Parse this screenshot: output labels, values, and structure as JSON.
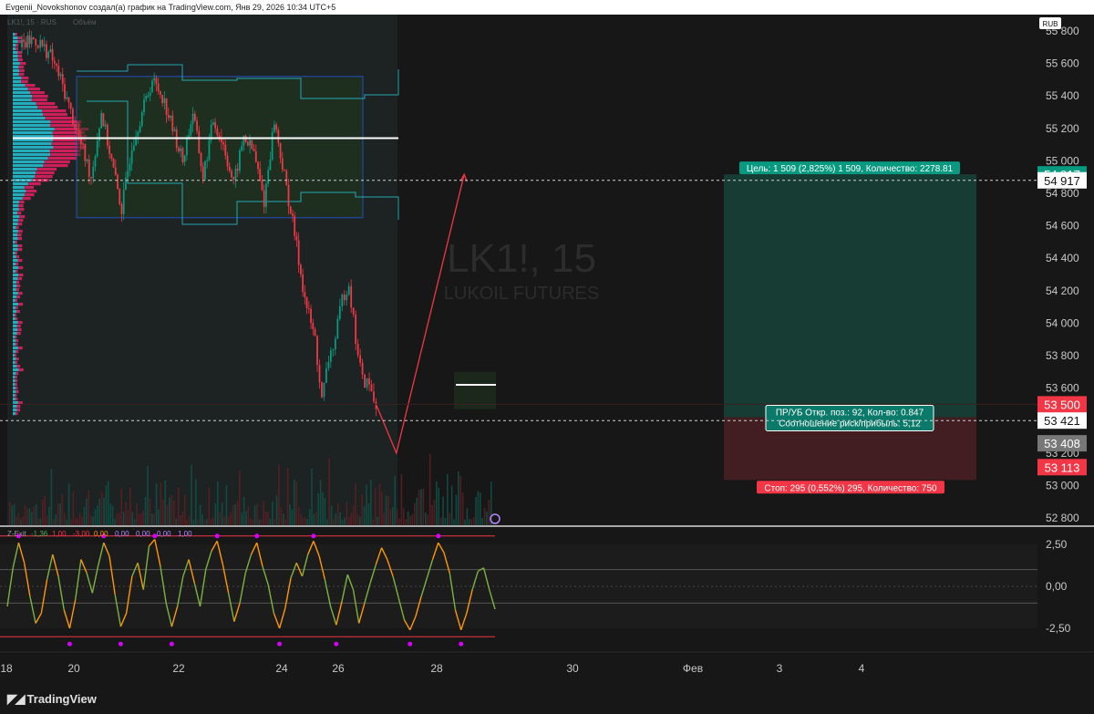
{
  "header": {
    "author_line": "Evgenii_Novokshonov создал(а) график на TradingView.com, Янв 29, 2026 10:34 UTC+5"
  },
  "legend": {
    "symbol_line": "LK1!, 15 · RUS",
    "volume_label": "Объём"
  },
  "currency_badge": "RUB",
  "watermark": {
    "symbol": "LK1!, 15",
    "name": "LUKOIL FUTURES"
  },
  "position": {
    "target_label": "Цель: 1 509 (2,825%) 1 509, Количество: 2278.81",
    "stop_label": "Стоп: 295 (0,552%) 295, Количество: 750",
    "pnl_line1": "ПР/УБ Откр. поз.: 92, Кол-во: 0.847",
    "pnl_line2": "Соотношение риск/прибыль: 5,12"
  },
  "price_tags": [
    {
      "text": "54 917",
      "price": 54917,
      "bg": "#089981",
      "fg": "#ffffff"
    },
    {
      "text": "54 917",
      "price": 54880,
      "bg": "#ffffff",
      "fg": "#111111"
    },
    {
      "text": "53 500",
      "price": 53500,
      "bg": "#f23645",
      "fg": "#ffffff"
    },
    {
      "text": "53 421",
      "price": 53400,
      "bg": "#ffffff",
      "fg": "#111111"
    },
    {
      "text": "53 408",
      "price": 53260,
      "bg": "#787878",
      "fg": "#ffffff"
    },
    {
      "text": "53 113",
      "price": 53113,
      "bg": "#f23645",
      "fg": "#ffffff"
    }
  ],
  "oscillator": {
    "legend_name": "Z-Exit",
    "legend_values": [
      {
        "text": "-1,36",
        "color": "#4caf50"
      },
      {
        "text": "1,00",
        "color": "#f23645"
      },
      {
        "text": "-3,00",
        "color": "#f23645"
      },
      {
        "text": "0,00",
        "color": "#ff9800"
      },
      {
        "text": "0,00",
        "color": "#b388ff"
      },
      {
        "text": "0,00",
        "color": "#b388ff"
      },
      {
        "text": "0,00",
        "color": "#b388ff"
      },
      {
        "text": "1,00",
        "color": "#b388ff"
      }
    ]
  },
  "colors": {
    "up": "#089981",
    "down": "#f23645",
    "box": "#2962ff",
    "profile_cyan": "#26c6da",
    "profile_pink": "#e91e63"
  },
  "chart_data": [
    {
      "type": "line",
      "title": "LK1!, 15",
      "subtitle": "LUKOIL FUTURES",
      "y_ticks": [
        55800,
        55600,
        55400,
        55200,
        55000,
        54800,
        54600,
        54400,
        54200,
        54000,
        53800,
        53600,
        53400,
        53200,
        53000,
        52800
      ],
      "y_tick_labels": [
        "55 800",
        "55 600",
        "55 400",
        "55 200",
        "55 000",
        "54 800",
        "54 600",
        "54 400",
        "54 200",
        "54 000",
        "53 800",
        "53 600",
        "53 400",
        "53 200",
        "53 000",
        "52 800"
      ],
      "ylim": [
        52800,
        55800
      ],
      "x_tick_labels": [
        "18",
        "20",
        "22",
        "24",
        "26",
        "28",
        "30",
        "Фев",
        "3",
        "4"
      ],
      "series": [
        {
          "x": [
            18.4,
            18.8,
            19.0,
            19.3,
            19.6,
            19.9,
            20.2,
            20.5,
            20.8,
            21.1,
            21.4,
            21.7,
            22.0,
            22.3,
            22.6,
            22.9,
            23.2,
            23.5,
            23.8,
            24.1,
            24.4,
            24.7,
            25.0,
            25.3,
            25.6,
            25.9,
            26.2,
            26.5,
            26.8,
            27.1,
            27.3,
            27.5,
            27.7,
            27.9,
            28.1,
            28.3,
            28.5,
            28.7,
            28.9
          ],
          "y": [
            55700,
            55750,
            55720,
            55650,
            55500,
            55300,
            55100,
            54900,
            55300,
            55000,
            54700,
            55100,
            55300,
            55500,
            55400,
            55200,
            55000,
            55300,
            54900,
            55250,
            55100,
            54850,
            55150,
            55050,
            54750,
            55250,
            54900,
            54550,
            54150,
            53900,
            53520,
            53780,
            53900,
            54150,
            54250,
            53900,
            53650,
            53620,
            53480
          ]
        }
      ],
      "annotations": {
        "poc_level": 55140,
        "range_box": {
          "x": [
            19.2,
            26.6
          ],
          "y": [
            54650,
            55520
          ]
        },
        "projection": {
          "x": [
            28.9,
            29.5,
            31.5
          ],
          "y": [
            53500,
            53200,
            54917
          ]
        },
        "position_entry": 53421,
        "position_target": 54917,
        "position_stop": 53113
      }
    },
    {
      "type": "line",
      "title": "Z-Exit",
      "y_tick_labels": [
        "2,50",
        "0,00",
        "-2,50"
      ],
      "y_ticks": [
        2.5,
        0,
        -2.5
      ],
      "ylim": [
        -3.4,
        3.4
      ],
      "levels": [
        3.0,
        1.0,
        -1.0,
        -3.0
      ],
      "series": [
        {
          "name": "Z-Exit",
          "values": [
            -1.2,
            1.1,
            2.6,
            1.4,
            -0.6,
            -2.2,
            -1.6,
            0.4,
            1.9,
            0.6,
            -1.4,
            -2.5,
            -0.8,
            1.6,
            0.8,
            -0.4,
            1.2,
            2.6,
            1.8,
            -0.5,
            -2.4,
            -1.6,
            0.6,
            1.4,
            -0.2,
            2.4,
            2.8,
            1.2,
            -1.0,
            -2.4,
            -1.2,
            0.6,
            1.6,
            0.2,
            -1.2,
            1.0,
            2.1,
            2.7,
            1.3,
            -0.4,
            -2.1,
            -1.0,
            0.8,
            1.9,
            2.6,
            1.2,
            0.1,
            -1.6,
            -2.5,
            -1.3,
            0.5,
            1.4,
            0.6,
            1.9,
            2.7,
            1.8,
            0.4,
            -1.2,
            -2.3,
            -0.9,
            0.7,
            -0.2,
            -2.2,
            -1.0,
            0.2,
            1.3,
            2.3,
            1.6,
            0.6,
            -0.7,
            -2.0,
            -2.6,
            -1.8,
            -0.6,
            0.5,
            1.6,
            2.6,
            2.0,
            0.8,
            -1.4,
            -2.6,
            -1.6,
            -0.2,
            0.9,
            1.1,
            -0.2,
            -1.36
          ]
        }
      ]
    }
  ]
}
